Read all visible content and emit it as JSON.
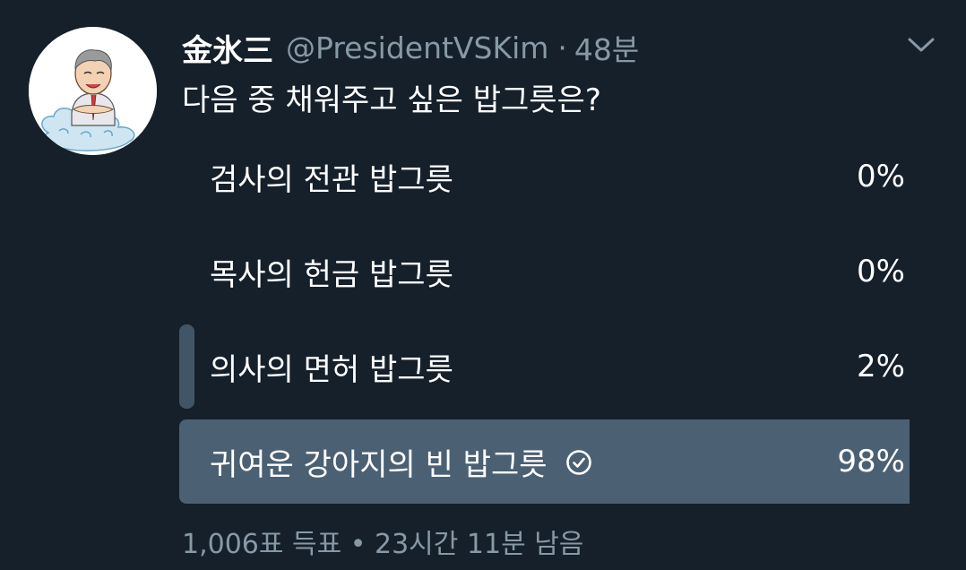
{
  "tweet": {
    "display_name": "金氷三",
    "handle": "@PresidentVSKim",
    "separator": "·",
    "time": "48분",
    "text": "다음 중 채워주고 싶은 밥그릇은?",
    "avatar_icon": "cartoon-portrait-avatar",
    "menu_icon": "chevron-down-icon"
  },
  "poll": {
    "options": [
      {
        "label": "검사의 전관 밥그릇",
        "percent_text": "0%",
        "percent": 0,
        "winner": false
      },
      {
        "label": "목사의 헌금 밥그릇",
        "percent_text": "0%",
        "percent": 0,
        "winner": false
      },
      {
        "label": "의사의 면허 밥그릇",
        "percent_text": "2%",
        "percent": 2,
        "winner": false
      },
      {
        "label": "귀여운 강아지의 빈 밥그릇",
        "percent_text": "98%",
        "percent": 98,
        "winner": true
      }
    ],
    "footer": "1,006표 득표 • 23시간 11분 남음",
    "winner_icon": "check-circle-icon"
  },
  "colors": {
    "background": "#15202b",
    "bar": "#425566",
    "winner_bar": "#4b6073",
    "secondary_text": "#8899a6"
  }
}
